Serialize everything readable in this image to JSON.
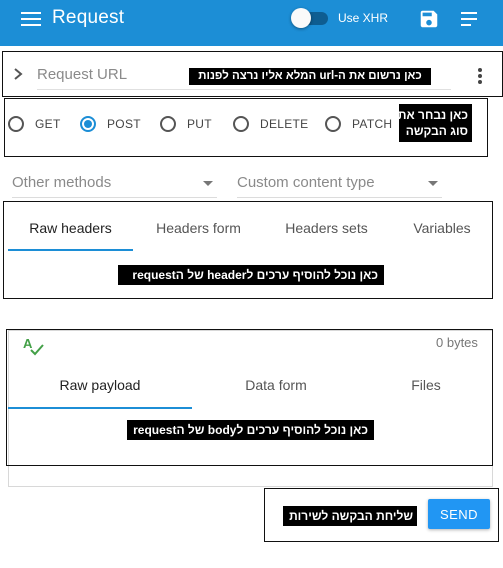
{
  "app": {
    "title": "Request",
    "xhr_label": "Use XHR",
    "xhr_enabled": false
  },
  "url": {
    "placeholder": "Request URL",
    "value": "",
    "note": "כאן נרשום את ה-url המלא אליו נרצה לפנות"
  },
  "methods": {
    "options": [
      "GET",
      "POST",
      "PUT",
      "DELETE",
      "PATCH"
    ],
    "selected": "POST",
    "note_line1": "כאן נבחר את",
    "note_line2": "סוג הבקשה"
  },
  "selects": {
    "other_methods": "Other methods",
    "content_type": "Custom content type"
  },
  "headers": {
    "tabs": [
      "Raw headers",
      "Headers form",
      "Headers sets",
      "Variables"
    ],
    "active_tab": "Raw headers",
    "note": "כאן נוכל להוסיף ערכים לheader של הrequest"
  },
  "body": {
    "size": "0 bytes",
    "tabs": [
      "Raw payload",
      "Data form",
      "Files"
    ],
    "active_tab": "Raw payload",
    "note": "כאן נוכל להוסיף ערכים לbody של הrequest"
  },
  "send": {
    "label": "SEND",
    "note": "שליחת הבקשה לשירות"
  },
  "icons": {
    "menu": "hamburger-icon",
    "save": "save-icon",
    "sort": "sort-lines-icon",
    "expand": "chevron-right-icon",
    "more": "more-vert-icon",
    "spellcheck": "spellcheck-icon"
  },
  "colors": {
    "primary": "#1c8ed6",
    "send_button": "#2196f3",
    "annotation_bg": "#000000"
  }
}
